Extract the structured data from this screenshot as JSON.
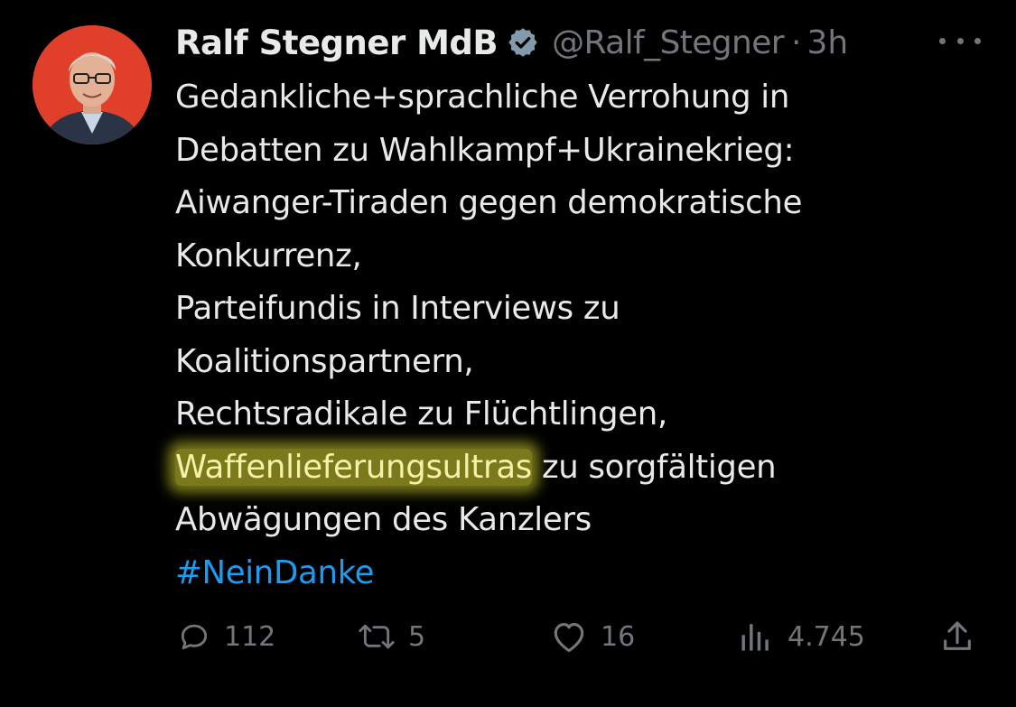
{
  "author": {
    "name": "Ralf Stegner MdB",
    "handle": "@Ralf_Stegner",
    "separator": "·",
    "time": "3h",
    "verified_icon": "verified-badge-icon"
  },
  "tweet": {
    "lines": [
      "Gedankliche+sprachliche Verrohung in",
      "Debatten zu Wahlkampf+Ukrainekrieg:",
      "Aiwanger-Tiraden gegen demokratische",
      "Konkurrenz,",
      "Parteifundis in Interviews zu",
      "Koalitionspartnern,",
      "Rechtsradikale zu Flüchtlingen,"
    ],
    "highlighted_word": "Waffenlieferungsultras",
    "highlight_line_rest": " zu sorgfältigen",
    "last_line": "Abwägungen des Kanzlers",
    "hashtag": "#NeinDanke"
  },
  "actions": {
    "replies": "112",
    "retweets": "5",
    "likes": "16",
    "views": "4.745"
  },
  "colors": {
    "background": "#000000",
    "text": "#e7e9ea",
    "muted": "#71767b",
    "link": "#1d9bf0",
    "verified": "#829aab",
    "highlight": "#7a7a1c",
    "avatar_bg": "#e0402a"
  }
}
